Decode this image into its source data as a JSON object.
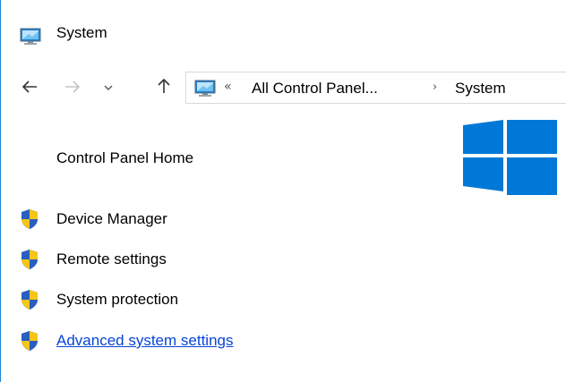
{
  "window": {
    "title": "System",
    "title_icon": "computer-monitor-icon",
    "accent": "#1e8ad6"
  },
  "navigation": {
    "back_icon": "arrow-left-icon",
    "forward_icon": "arrow-right-icon",
    "recent_icon": "chevron-down-icon",
    "up_icon": "arrow-up-icon",
    "forward_enabled": false
  },
  "address_bar": {
    "icon": "computer-monitor-icon",
    "overflow_glyph": "«",
    "segments": [
      "All Control Panel...",
      "System"
    ],
    "separator_glyph": "›"
  },
  "logo": {
    "icon": "windows-logo-icon",
    "color": "#0078d7"
  },
  "sidebar": {
    "home_label": "Control Panel Home",
    "tasks": [
      {
        "label": "Device Manager",
        "icon": "uac-shield-icon",
        "is_link_style": false
      },
      {
        "label": "Remote settings",
        "icon": "uac-shield-icon",
        "is_link_style": false
      },
      {
        "label": "System protection",
        "icon": "uac-shield-icon",
        "is_link_style": false
      },
      {
        "label": "Advanced system settings",
        "icon": "uac-shield-icon",
        "is_link_style": true
      }
    ],
    "link_color": "#0645d6"
  }
}
